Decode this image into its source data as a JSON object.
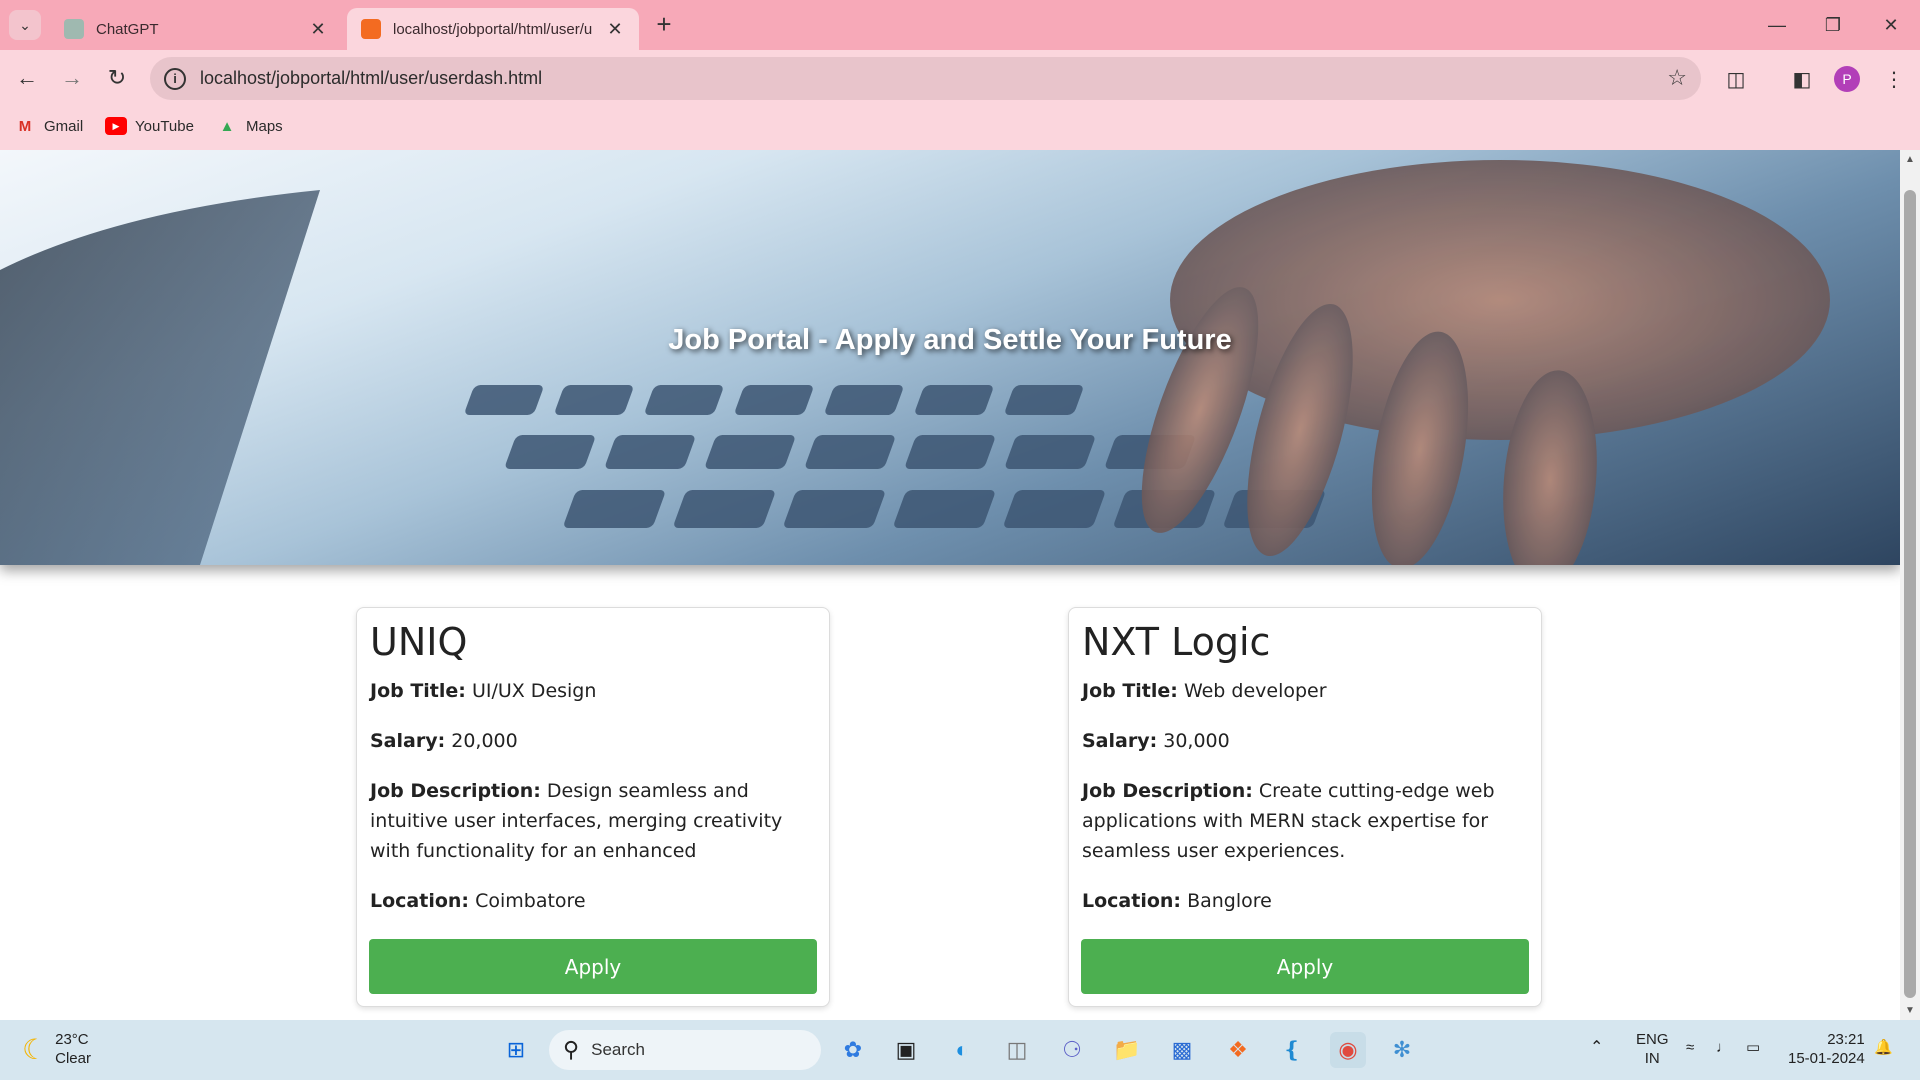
{
  "browser": {
    "tabs": [
      {
        "title": "ChatGPT",
        "active": false
      },
      {
        "title": "localhost/jobportal/html/user/u",
        "active": true
      }
    ],
    "url": "localhost/jobportal/html/user/userdash.html",
    "profile_initial": "P",
    "bookmarks": [
      "Gmail",
      "YouTube",
      "Maps"
    ]
  },
  "page": {
    "hero_title": "Job Portal - Apply and Settle Your Future",
    "jobs": [
      {
        "company": "UNIQ",
        "title_label": "Job Title:",
        "title": "UI/UX Design",
        "salary_label": "Salary:",
        "salary": "20,000",
        "description_label": "Job Description:",
        "description": "Design seamless and intuitive user interfaces, merging creativity with functionality for an enhanced",
        "location_label": "Location:",
        "location": "Coimbatore",
        "apply_label": "Apply"
      },
      {
        "company": "NXT Logic",
        "title_label": "Job Title:",
        "title": "Web developer",
        "salary_label": "Salary:",
        "salary": "30,000",
        "description_label": "Job Description:",
        "description": "Create cutting-edge web applications with MERN stack expertise for seamless user experiences.",
        "location_label": "Location:",
        "location": "Banglore",
        "apply_label": "Apply"
      }
    ]
  },
  "taskbar": {
    "weather_temp": "23°C",
    "weather_desc": "Clear",
    "search_label": "Search",
    "lang_top": "ENG",
    "lang_bottom": "IN",
    "time": "23:21",
    "date": "15-01-2024"
  },
  "colors": {
    "tabbar": "#f7a9b8",
    "toolbar": "#fbd6dd",
    "apply_button": "#4caf50",
    "taskbar": "#d6e6ef"
  }
}
